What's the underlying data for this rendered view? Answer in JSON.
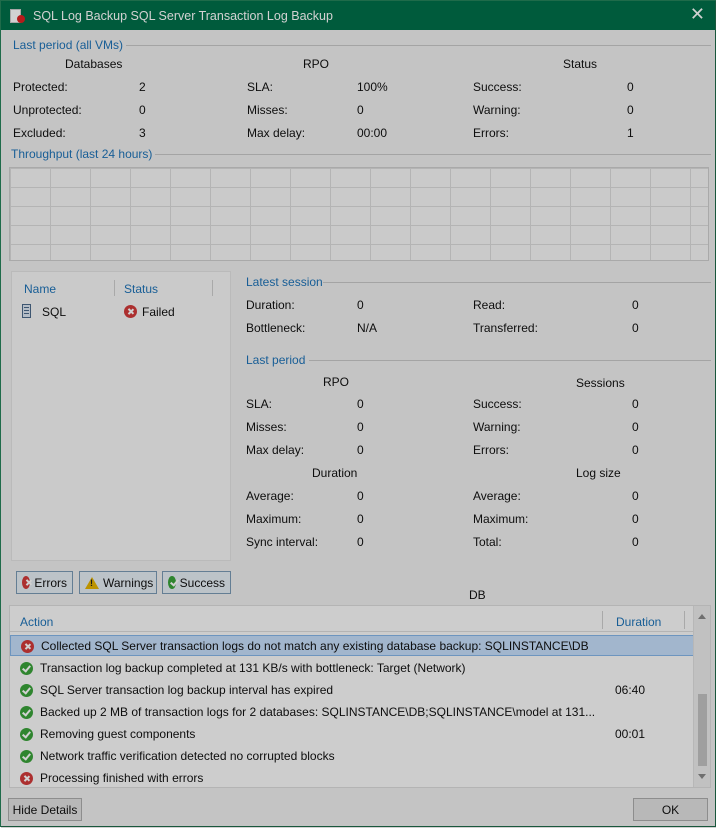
{
  "window": {
    "title": "SQL Log Backup SQL Server Transaction Log Backup",
    "close_glyph": "✕"
  },
  "last_period_all": {
    "title": "Last period (all VMs)",
    "databases": {
      "header": "Databases",
      "rows": [
        {
          "label": "Protected:",
          "value": "2"
        },
        {
          "label": "Unprotected:",
          "value": "0"
        },
        {
          "label": "Excluded:",
          "value": "3"
        }
      ]
    },
    "rpo": {
      "header": "RPO",
      "rows": [
        {
          "label": "SLA:",
          "value": "100%"
        },
        {
          "label": "Misses:",
          "value": "0"
        },
        {
          "label": "Max delay:",
          "value": "00:00"
        }
      ]
    },
    "status": {
      "header": "Status",
      "rows": [
        {
          "label": "Success:",
          "value": "0"
        },
        {
          "label": "Warning:",
          "value": "0"
        },
        {
          "label": "Errors:",
          "value": "1"
        }
      ]
    }
  },
  "throughput": {
    "title": "Throughput (last 24 hours)"
  },
  "vm_list": {
    "columns": [
      "Name",
      "Status"
    ],
    "rows": [
      {
        "name": "SQL",
        "status": "Failed",
        "status_icon": "error-icon"
      }
    ]
  },
  "latest_session": {
    "title": "Latest session",
    "left": [
      {
        "label": "Duration:",
        "value": "0"
      },
      {
        "label": "Bottleneck:",
        "value": "N/A"
      }
    ],
    "right": [
      {
        "label": "Read:",
        "value": "0"
      },
      {
        "label": "Transferred:",
        "value": "0"
      }
    ]
  },
  "last_period": {
    "title": "Last period",
    "rpo": {
      "header": "RPO",
      "rows": [
        {
          "label": "SLA:",
          "value": "0"
        },
        {
          "label": "Misses:",
          "value": "0"
        },
        {
          "label": "Max delay:",
          "value": "0"
        }
      ]
    },
    "sessions": {
      "header": "Sessions",
      "rows": [
        {
          "label": "Success:",
          "value": "0"
        },
        {
          "label": "Warning:",
          "value": "0"
        },
        {
          "label": "Errors:",
          "value": "0"
        }
      ]
    },
    "duration": {
      "header": "Duration",
      "rows": [
        {
          "label": "Average:",
          "value": "0"
        },
        {
          "label": "Maximum:",
          "value": "0"
        },
        {
          "label": "Sync interval:",
          "value": "0"
        }
      ]
    },
    "log_size": {
      "header": "Log size",
      "rows": [
        {
          "label": "Average:",
          "value": "0"
        },
        {
          "label": "Maximum:",
          "value": "0"
        },
        {
          "label": "Total:",
          "value": "0"
        }
      ]
    }
  },
  "filters": {
    "errors": "Errors",
    "warnings": "Warnings",
    "success": "Success"
  },
  "db_label": "DB",
  "log": {
    "columns": {
      "action": "Action",
      "duration": "Duration"
    },
    "rows": [
      {
        "icon": "error",
        "text": "Collected SQL Server transaction logs do not match any existing database backup: SQLINSTANCE\\DB",
        "duration": "",
        "selected": true
      },
      {
        "icon": "ok",
        "text": "Transaction log backup completed at 131 KB/s with bottleneck: Target (Network)",
        "duration": ""
      },
      {
        "icon": "ok",
        "text": "SQL Server transaction log backup interval has expired",
        "duration": "06:40"
      },
      {
        "icon": "ok",
        "text": "Backed up 2 MB of transaction logs for 2 databases: SQLINSTANCE\\DB;SQLINSTANCE\\model at 131...",
        "duration": ""
      },
      {
        "icon": "ok",
        "text": "Removing guest components",
        "duration": "00:01"
      },
      {
        "icon": "ok",
        "text": "Network traffic verification detected no corrupted blocks",
        "duration": ""
      },
      {
        "icon": "error",
        "text": "Processing finished with errors",
        "duration": ""
      }
    ]
  },
  "footer": {
    "hide_details": "Hide Details",
    "ok": "OK"
  },
  "colors": {
    "titlebar": "#00704a",
    "link": "#1e73b8",
    "selection": "#c6defa",
    "error": "#d23a3a",
    "success": "#3aa33a"
  }
}
